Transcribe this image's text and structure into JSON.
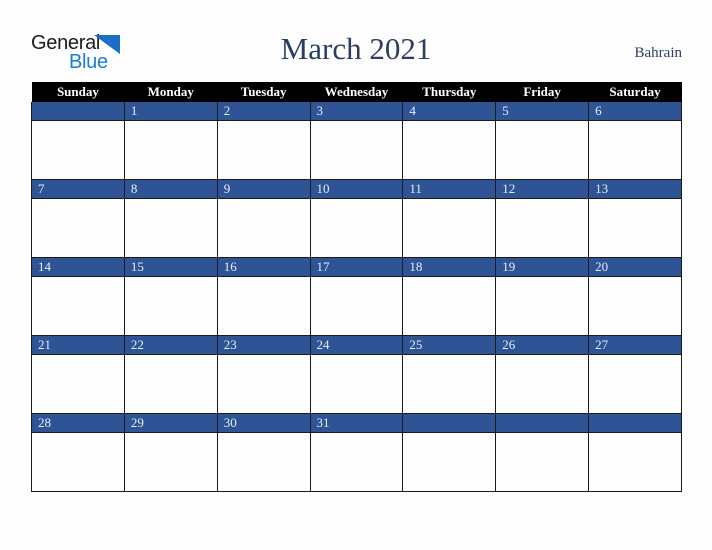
{
  "logo": {
    "word_one": "General",
    "word_two": "Blue",
    "triangle_icon": "triangle-icon",
    "brand_blue": "#1a7fd4",
    "brand_dark": "#1c1c1c"
  },
  "header": {
    "title": "March 2021",
    "month": "March",
    "year": "2021",
    "locale": "Bahrain",
    "title_color": "#2c3e60"
  },
  "calendar": {
    "weekday_headers": [
      "Sunday",
      "Monday",
      "Tuesday",
      "Wednesday",
      "Thursday",
      "Friday",
      "Saturday"
    ],
    "header_bg": "#000000",
    "header_text": "#ffffff",
    "daynum_bg": "#2e5496",
    "daynum_text": "#e8ecf5",
    "cell_bg": "#fdfdfd",
    "border_color": "#1b1b1b",
    "weeks": [
      {
        "days": [
          "",
          "1",
          "2",
          "3",
          "4",
          "5",
          "6"
        ]
      },
      {
        "days": [
          "7",
          "8",
          "9",
          "10",
          "11",
          "12",
          "13"
        ]
      },
      {
        "days": [
          "14",
          "15",
          "16",
          "17",
          "18",
          "19",
          "20"
        ]
      },
      {
        "days": [
          "21",
          "22",
          "23",
          "24",
          "25",
          "26",
          "27"
        ]
      },
      {
        "days": [
          "28",
          "29",
          "30",
          "31",
          "",
          "",
          ""
        ]
      }
    ]
  },
  "page": {
    "background": "#fdfdfd"
  }
}
